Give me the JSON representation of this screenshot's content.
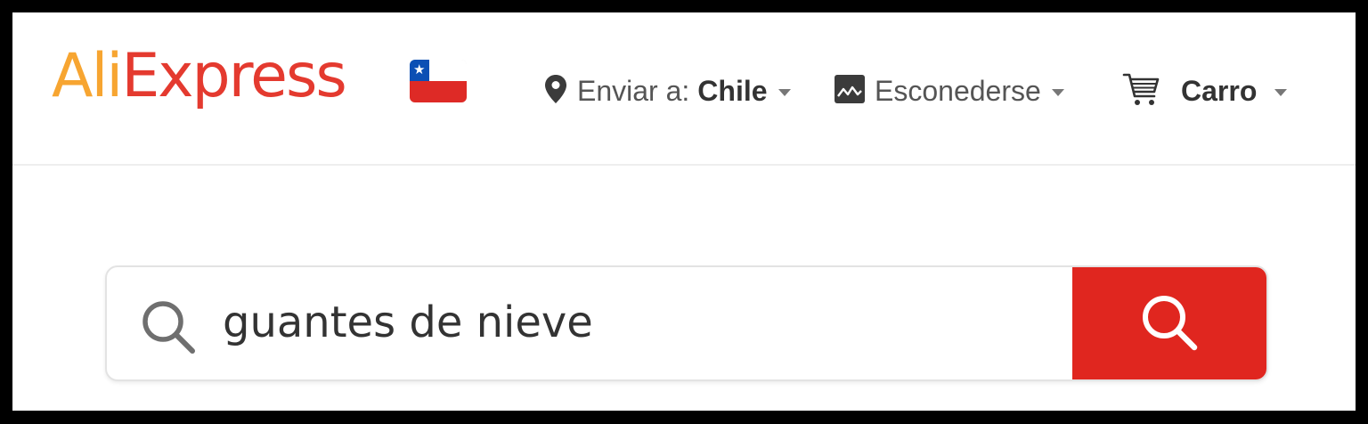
{
  "brand": {
    "logo_ali": "Ali",
    "logo_express": "Express",
    "flag_icon": "chile-flag-icon",
    "colors": {
      "ali_orange": "#f7a531",
      "express_red": "#e43a2f",
      "accent_red": "#e0261f"
    }
  },
  "header": {
    "ship_to": {
      "icon": "location-pin-icon",
      "label": "Enviar a:",
      "country": "Chile"
    },
    "hide": {
      "icon": "image-icon",
      "label": "Esconederse"
    },
    "cart": {
      "icon": "cart-icon",
      "label": "Carro"
    }
  },
  "search": {
    "value": "guantes de nieve",
    "icon": "search-icon",
    "button_icon": "search-icon"
  }
}
